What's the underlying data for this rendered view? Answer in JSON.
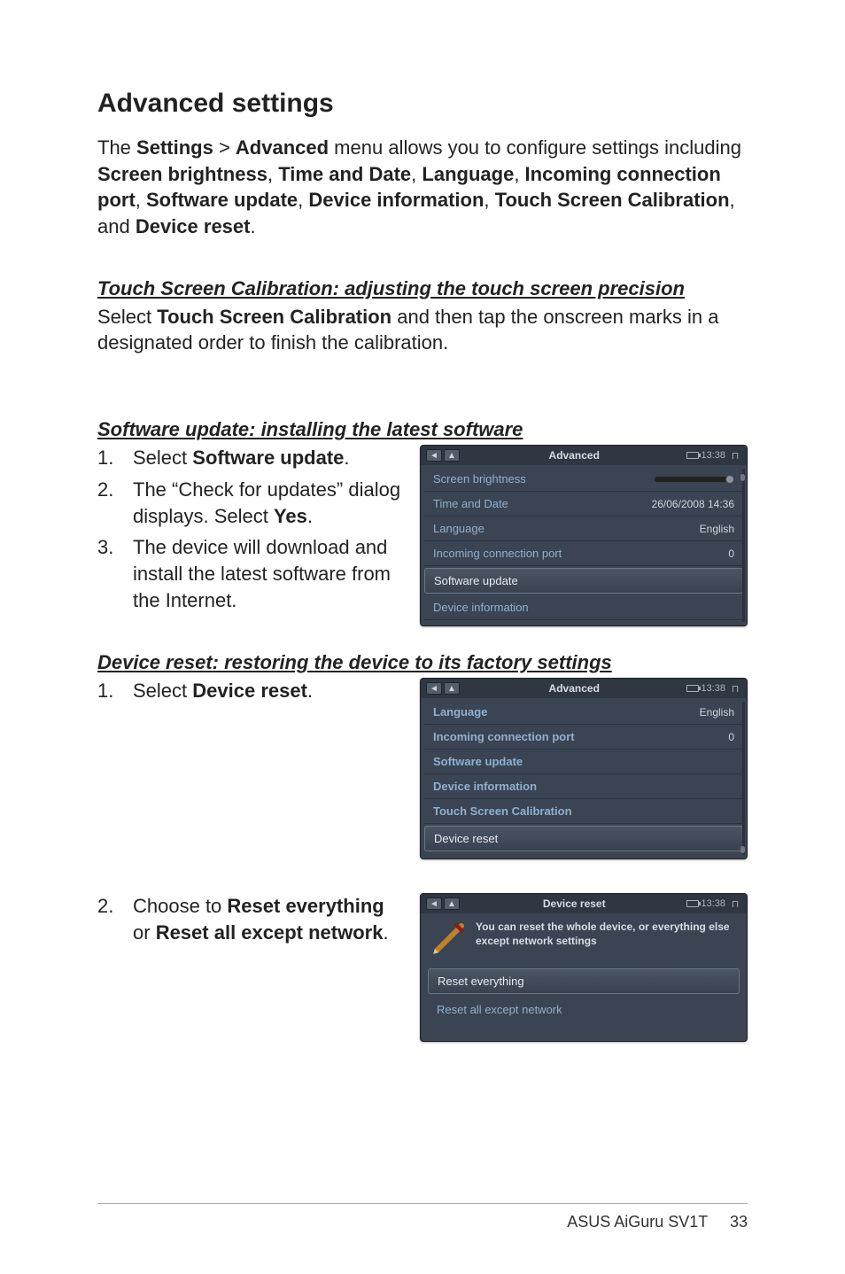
{
  "title": "Advanced settings",
  "intro": {
    "prefix": "The ",
    "settings": "Settings",
    "gt": " > ",
    "advanced": "Advanced",
    "mid1": " menu allows you to configure settings including ",
    "b1": "Screen brightness",
    "c": ", ",
    "b2": "Time and Date",
    "b3": "Language",
    "b4": "Incoming connection port",
    "b5": "Software update",
    "b6": "Device information",
    "b7": "Touch Screen Calibration",
    "and": ", and ",
    "b8": "Device reset",
    "end": "."
  },
  "touch": {
    "heading": "Touch Screen Calibration: adjusting the touch screen precision",
    "p_pre": "Select ",
    "p_b": "Touch Screen Calibration",
    "p_post": " and then tap the onscreen marks in a designated order to finish the calibration."
  },
  "swupdate": {
    "heading": "Software update: installing the latest software",
    "steps": [
      {
        "num": "1.",
        "pre": "Select ",
        "b": "Software update",
        "post": "."
      },
      {
        "num": "2.",
        "pre": "The “Check for updates” dialog displays. Select ",
        "b": "Yes",
        "post": "."
      },
      {
        "num": "3.",
        "pre": "The device will download and install the latest software from the Internet.",
        "b": "",
        "post": ""
      }
    ]
  },
  "device1": {
    "title": "Advanced",
    "time": "13:38",
    "items": [
      {
        "label": "Screen brightness",
        "val_type": "slider"
      },
      {
        "label": "Time and Date",
        "val": "26/06/2008 14:36"
      },
      {
        "label": "Language",
        "val": "English"
      },
      {
        "label": "Incoming connection port",
        "val": "0"
      },
      {
        "label": "Software update",
        "selected": true
      },
      {
        "label": "Device information"
      }
    ]
  },
  "devreset": {
    "heading": "Device reset: restoring the device to its factory settings",
    "step1": {
      "num": "1.",
      "pre": "Select ",
      "b": "Device reset",
      "post": "."
    },
    "step2": {
      "num": "2.",
      "pre": "Choose to ",
      "b1": "Reset everything",
      "mid": " or ",
      "b2": "Reset all except network",
      "post": "."
    }
  },
  "device2": {
    "title": "Advanced",
    "time": "13:38",
    "items": [
      {
        "label": "Language",
        "val": "English"
      },
      {
        "label": "Incoming connection port",
        "val": "0"
      },
      {
        "label": "Software update"
      },
      {
        "label": "Device information"
      },
      {
        "label": "Touch Screen Calibration"
      },
      {
        "label": "Device reset",
        "selected": true
      }
    ]
  },
  "device3": {
    "title": "Device reset",
    "time": "13:38",
    "msg": "You can reset the whole device, or everything else except network settings",
    "btn1": "Reset everything",
    "btn2": "Reset all except network"
  },
  "footer": {
    "product": "ASUS AiGuru SV1T",
    "page": "33"
  }
}
